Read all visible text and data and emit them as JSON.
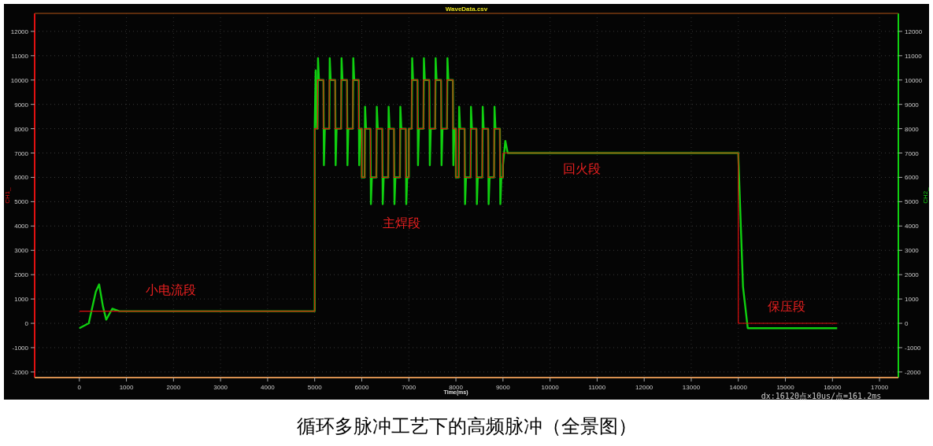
{
  "chart_panel": {
    "info": "dx:16120点×10us/点=161.2ms",
    "chart_data": {
      "type": "line",
      "title": "WaveData.csv",
      "xlabel": "Time(ms)",
      "xlim": [
        -950,
        17400
      ],
      "ylim": [
        -2230,
        12740
      ],
      "xticks": [
        0,
        1000,
        2000,
        3000,
        4000,
        5000,
        6000,
        7000,
        8000,
        9000,
        10000,
        11000,
        12000,
        13000,
        14000,
        15000,
        16000,
        17000
      ],
      "yticks": [
        -2000,
        -1000,
        0,
        1000,
        2000,
        3000,
        4000,
        5000,
        6000,
        7000,
        8000,
        9000,
        10000,
        11000,
        12000
      ],
      "x": [
        0,
        200,
        350,
        420,
        500,
        570,
        700,
        850,
        5000,
        5000,
        5020,
        5045,
        5060,
        5060,
        5070,
        5090,
        5185,
        5185,
        5195,
        5215,
        5310,
        5310,
        5320,
        5340,
        5435,
        5435,
        5445,
        5465,
        5560,
        5560,
        5570,
        5590,
        5685,
        5685,
        5695,
        5715,
        5810,
        5810,
        5820,
        5840,
        5935,
        5935,
        5945,
        5965,
        6000,
        6000,
        6060,
        6060,
        6070,
        6090,
        6185,
        6185,
        6195,
        6215,
        6310,
        6310,
        6320,
        6340,
        6435,
        6435,
        6445,
        6465,
        6560,
        6560,
        6570,
        6590,
        6685,
        6685,
        6695,
        6715,
        6810,
        6810,
        6820,
        6840,
        6935,
        6935,
        6945,
        6965,
        7000,
        7000,
        7060,
        7060,
        7070,
        7090,
        7185,
        7185,
        7195,
        7215,
        7310,
        7310,
        7320,
        7340,
        7435,
        7435,
        7445,
        7465,
        7560,
        7560,
        7570,
        7590,
        7685,
        7685,
        7695,
        7715,
        7810,
        7810,
        7820,
        7840,
        7935,
        7935,
        7945,
        7965,
        8000,
        8000,
        8060,
        8060,
        8070,
        8090,
        8185,
        8185,
        8195,
        8215,
        8310,
        8310,
        8320,
        8340,
        8435,
        8435,
        8445,
        8465,
        8560,
        8560,
        8570,
        8590,
        8685,
        8685,
        8695,
        8715,
        8810,
        8810,
        8820,
        8840,
        8935,
        8935,
        8945,
        8965,
        9000,
        9000,
        9050,
        9100,
        14000,
        14000,
        14100,
        14200,
        16100
      ],
      "series": [
        {
          "name": "CH1_",
          "color": "#e01010",
          "values": [
            500,
            500,
            500,
            500,
            500,
            500,
            500,
            500,
            500,
            8000,
            8000,
            8000,
            8000,
            10000,
            10000,
            10000,
            10000,
            8000,
            8000,
            8000,
            8000,
            10000,
            10000,
            10000,
            10000,
            8000,
            8000,
            8000,
            8000,
            10000,
            10000,
            10000,
            10000,
            8000,
            8000,
            8000,
            8000,
            10000,
            10000,
            10000,
            10000,
            8000,
            8000,
            8000,
            8000,
            6000,
            6000,
            8000,
            8000,
            8000,
            8000,
            6000,
            6000,
            6000,
            6000,
            8000,
            8000,
            8000,
            8000,
            6000,
            6000,
            6000,
            6000,
            8000,
            8000,
            8000,
            8000,
            6000,
            6000,
            6000,
            6000,
            8000,
            8000,
            8000,
            8000,
            6000,
            6000,
            6000,
            6000,
            8000,
            8000,
            10000,
            10000,
            10000,
            10000,
            8000,
            8000,
            8000,
            8000,
            10000,
            10000,
            10000,
            10000,
            8000,
            8000,
            8000,
            8000,
            10000,
            10000,
            10000,
            10000,
            8000,
            8000,
            8000,
            8000,
            10000,
            10000,
            10000,
            10000,
            8000,
            8000,
            8000,
            8000,
            6000,
            6000,
            8000,
            8000,
            8000,
            8000,
            6000,
            6000,
            6000,
            6000,
            8000,
            8000,
            8000,
            8000,
            6000,
            6000,
            6000,
            6000,
            8000,
            8000,
            8000,
            8000,
            6000,
            6000,
            6000,
            6000,
            8000,
            8000,
            8000,
            8000,
            6000,
            6000,
            6000,
            6000,
            7000,
            7000,
            7000,
            7000,
            0,
            0,
            0,
            0
          ]
        },
        {
          "name": "CH2_",
          "color": "#10d010",
          "values": [
            -200,
            0,
            1300,
            1600,
            700,
            150,
            600,
            500,
            500,
            8000,
            10400,
            8000,
            8000,
            8000,
            10900,
            10000,
            10000,
            10000,
            6500,
            8000,
            8000,
            8000,
            10900,
            10000,
            10000,
            10000,
            6500,
            8000,
            8000,
            8000,
            10900,
            10000,
            10000,
            10000,
            6500,
            8000,
            8000,
            8000,
            10900,
            10000,
            10000,
            10000,
            6500,
            8000,
            8000,
            6000,
            6000,
            6000,
            8900,
            8000,
            8000,
            8000,
            4900,
            6000,
            6000,
            6000,
            8900,
            8000,
            8000,
            8000,
            4900,
            6000,
            6000,
            6000,
            8900,
            8000,
            8000,
            8000,
            4900,
            6000,
            6000,
            6000,
            8900,
            8000,
            8000,
            8000,
            4900,
            6000,
            6000,
            8000,
            8000,
            8000,
            10900,
            10000,
            10000,
            10000,
            6500,
            8000,
            8000,
            8000,
            10900,
            10000,
            10000,
            10000,
            6500,
            8000,
            8000,
            8000,
            10900,
            10000,
            10000,
            10000,
            6500,
            8000,
            8000,
            8000,
            10900,
            10000,
            10000,
            10000,
            6500,
            8000,
            8000,
            6000,
            6000,
            6000,
            8900,
            8000,
            8000,
            8000,
            4900,
            6000,
            6000,
            6000,
            8900,
            8000,
            8000,
            8000,
            4900,
            6000,
            6000,
            6000,
            8900,
            8000,
            8000,
            8000,
            4900,
            6000,
            6000,
            6000,
            8900,
            8000,
            8000,
            8000,
            4900,
            6000,
            6000,
            6500,
            7500,
            7000,
            7000,
            6900,
            1500,
            -200,
            -200
          ]
        }
      ],
      "grid": true,
      "y2lim": [
        -2230,
        12740
      ],
      "y2ticks": [
        -2000,
        -1000,
        0,
        1000,
        2000,
        3000,
        4000,
        5000,
        6000,
        7000,
        8000,
        9000,
        10000,
        11000,
        12000
      ],
      "annotations": [
        "小电流段",
        "主焊段",
        "回火段",
        "保压段"
      ]
    }
  },
  "caption": "循环多脉冲工艺下的高频脉冲（全景图）"
}
